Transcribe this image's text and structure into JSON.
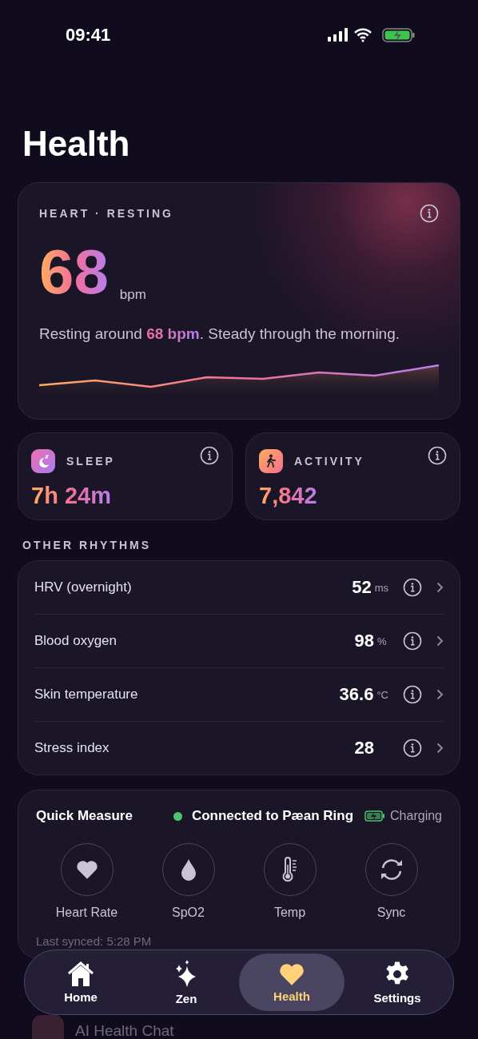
{
  "status_bar": {
    "time": "09:41"
  },
  "title": "Health",
  "heart_card": {
    "label": "HEART · RESTING",
    "value": "68",
    "unit": "bpm",
    "summary": "Resting around **68 bpm**. Steady through the morning."
  },
  "summary_cards": [
    {
      "kind": "sleep",
      "label": "SLEEP",
      "value": "7h 24m"
    },
    {
      "kind": "activity",
      "label": "ACTIVITY",
      "value": "7,842"
    }
  ],
  "other_rhythms": {
    "heading": "OTHER RHYTHMS",
    "rows": [
      {
        "name": "HRV (overnight)",
        "value": "52",
        "unit": "ms"
      },
      {
        "name": "Blood oxygen",
        "value": "98",
        "unit": "%"
      },
      {
        "name": "Skin temperature",
        "value": "36.6",
        "unit": "°C"
      },
      {
        "name": "Stress index",
        "value": "28"
      }
    ]
  },
  "quick_measure": {
    "title": "Quick Measure",
    "connection": "Connected to Pæan Ring",
    "connected": true,
    "battery": "Charging",
    "last_synced": "Last synced: 5:28 PM",
    "actions": [
      {
        "kind": "heart",
        "label": "Heart Rate"
      },
      {
        "kind": "drop",
        "label": "SpO2"
      },
      {
        "kind": "thermometer",
        "label": "Temp"
      },
      {
        "kind": "sync",
        "label": "Sync"
      }
    ]
  },
  "insights": {
    "row": "AI Health Chat"
  },
  "tabs": [
    {
      "kind": "home",
      "label": "Home",
      "selected": false
    },
    {
      "kind": "zen",
      "label": "Zen",
      "selected": false
    },
    {
      "kind": "health",
      "label": "Health",
      "selected": true
    },
    {
      "kind": "settings",
      "label": "Settings",
      "selected": false
    }
  ]
}
